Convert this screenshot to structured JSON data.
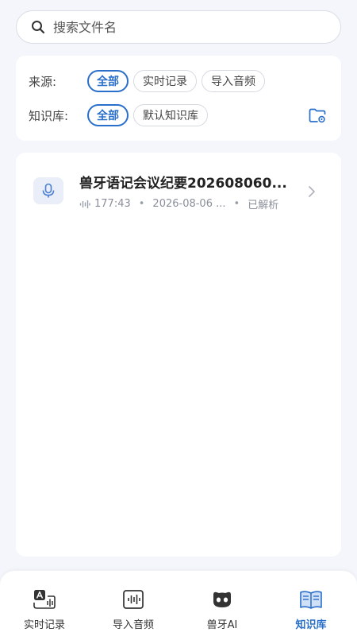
{
  "search": {
    "placeholder": "搜索文件名"
  },
  "filters": {
    "source": {
      "label": "来源:",
      "options": [
        "全部",
        "实时记录",
        "导入音频"
      ]
    },
    "library": {
      "label": "知识库:",
      "options": [
        "全部",
        "默认知识库"
      ]
    }
  },
  "files": [
    {
      "title": "兽牙语记会议纪要202608060...",
      "duration": "177:43",
      "date": "2026-08-06 ...",
      "status": "已解析"
    }
  ],
  "nav": {
    "tabs": [
      "实时记录",
      "导入音频",
      "兽牙AI",
      "知识库"
    ],
    "active": "知识库"
  },
  "colors": {
    "accent": "#2a6fc9",
    "background": "#f4f6fb"
  }
}
